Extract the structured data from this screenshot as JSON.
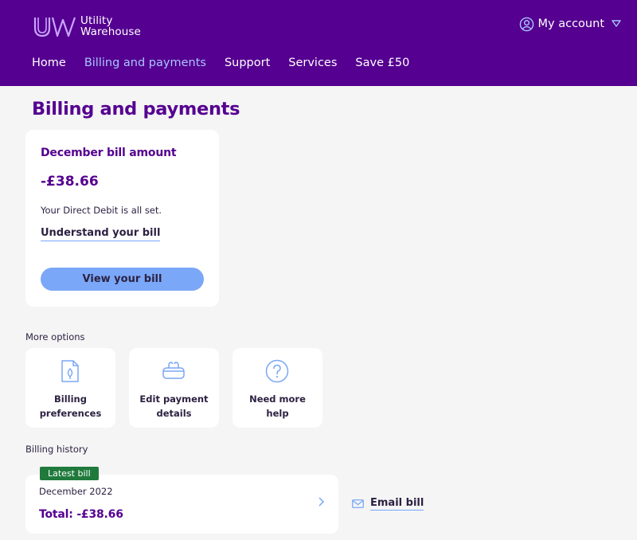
{
  "header": {
    "logo_line1": "Utility",
    "logo_line2": "Warehouse",
    "account_label": "My account",
    "nav": [
      "Home",
      "Billing and payments",
      "Support",
      "Services",
      "Save £50"
    ]
  },
  "page": {
    "title": "Billing and payments"
  },
  "bill_card": {
    "heading": "December bill amount",
    "amount": "-£38.66",
    "status": "Your Direct Debit is all set.",
    "understand_link": "Understand your bill",
    "view_button": "View your bill"
  },
  "more_options": {
    "label": "More options",
    "items": [
      {
        "line1": "Billing",
        "line2": "preferences",
        "icon": "document-leaf-icon"
      },
      {
        "line1": "Edit payment",
        "line2": "details",
        "icon": "purse-icon"
      },
      {
        "line1": "Need more",
        "line2": "help",
        "icon": "question-icon"
      }
    ]
  },
  "billing_history": {
    "label": "Billing history",
    "badge": "Latest bill",
    "date": "December 2022",
    "total": "Total: -£38.66",
    "email_link": "Email bill"
  },
  "colors": {
    "brand_purple": "#550090",
    "accent_blue": "#7aa7f7",
    "active_nav": "#a9c4ff",
    "badge_green": "#1f7a3c"
  }
}
